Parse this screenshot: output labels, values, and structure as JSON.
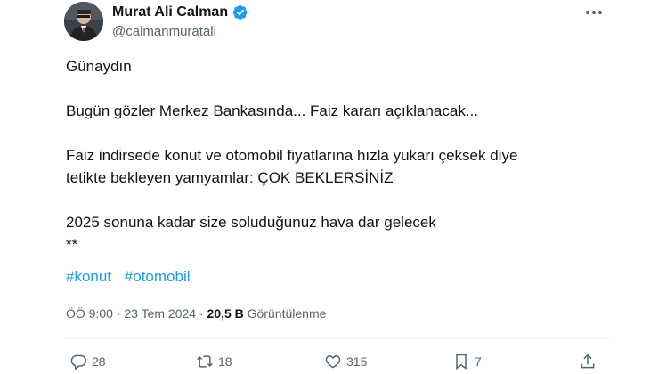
{
  "author": {
    "display_name": "Murat Ali Calman",
    "handle": "@calmanmuratali",
    "verified": true
  },
  "tweet": {
    "lines": [
      "Günaydın",
      "",
      "Bugün gözler Merkez Bankasında... Faiz kararı açıklanacak...",
      "",
      "Faiz indirsede konut ve otomobil fiyatlarına hızla yukarı çeksek diye",
      "tetikte bekleyen yamyamlar: ÇOK BEKLERSİNİZ",
      "",
      "2025 sonuna kadar size soluduğunuz hava dar gelecek",
      "**"
    ],
    "hashtags": [
      "#konut",
      "#otomobil"
    ]
  },
  "meta": {
    "time": "ÖÖ 9:00",
    "separator": "·",
    "date": "23 Tem 2024",
    "views_count": "20,5 B",
    "views_label": "Görüntülenme"
  },
  "actions": {
    "replies": "28",
    "retweets": "18",
    "likes": "315",
    "bookmarks": "7"
  },
  "colors": {
    "link": "#1d9bf0",
    "secondary": "#536471",
    "text": "#0f1419"
  },
  "icons": [
    "verified-badge-icon",
    "more-options-icon",
    "reply-icon",
    "retweet-icon",
    "like-icon",
    "bookmark-icon",
    "share-icon"
  ]
}
